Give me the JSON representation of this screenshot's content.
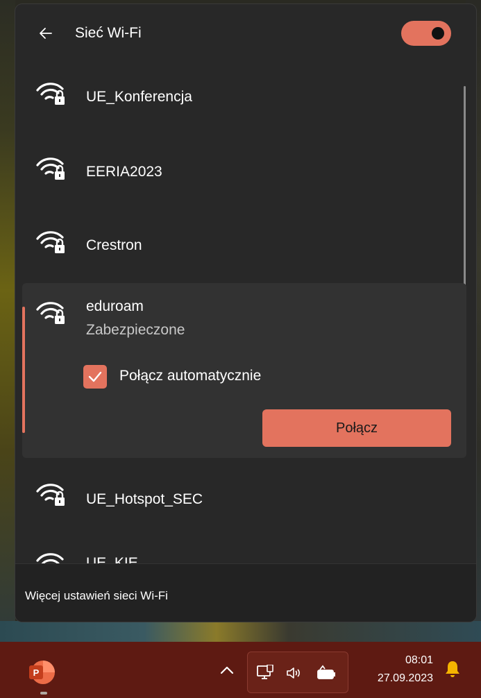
{
  "header": {
    "title": "Sieć Wi-Fi",
    "back_icon": "arrow-left-icon",
    "toggle_state": "on"
  },
  "networks": [
    {
      "ssid": "UE_Konferencja",
      "icon": "wifi-secured-icon"
    },
    {
      "ssid": "EERIA2023",
      "icon": "wifi-secured-icon"
    },
    {
      "ssid": "Crestron",
      "icon": "wifi-secured-icon"
    },
    {
      "ssid": "eduroam",
      "icon": "wifi-secured-icon",
      "status": "Zabezpieczone",
      "selected": true
    },
    {
      "ssid": "UE_Hotspot_SEC",
      "icon": "wifi-secured-icon"
    },
    {
      "ssid": "UE_KIE",
      "icon": "wifi-secured-icon"
    }
  ],
  "selected_network": {
    "auto_connect_label": "Połącz automatycznie",
    "auto_connect_checked": true,
    "connect_button": "Połącz"
  },
  "footer": {
    "more_settings": "Więcej ustawień sieci Wi-Fi"
  },
  "taskbar": {
    "time": "08:01",
    "date": "27.09.2023",
    "app_icon": "powerpoint-icon",
    "tray_icons": [
      "network-icon",
      "volume-icon",
      "battery-icon"
    ]
  },
  "colors": {
    "accent": "#e3735e",
    "flyout_bg": "#282828",
    "taskbar_bg": "#5e1a12"
  }
}
